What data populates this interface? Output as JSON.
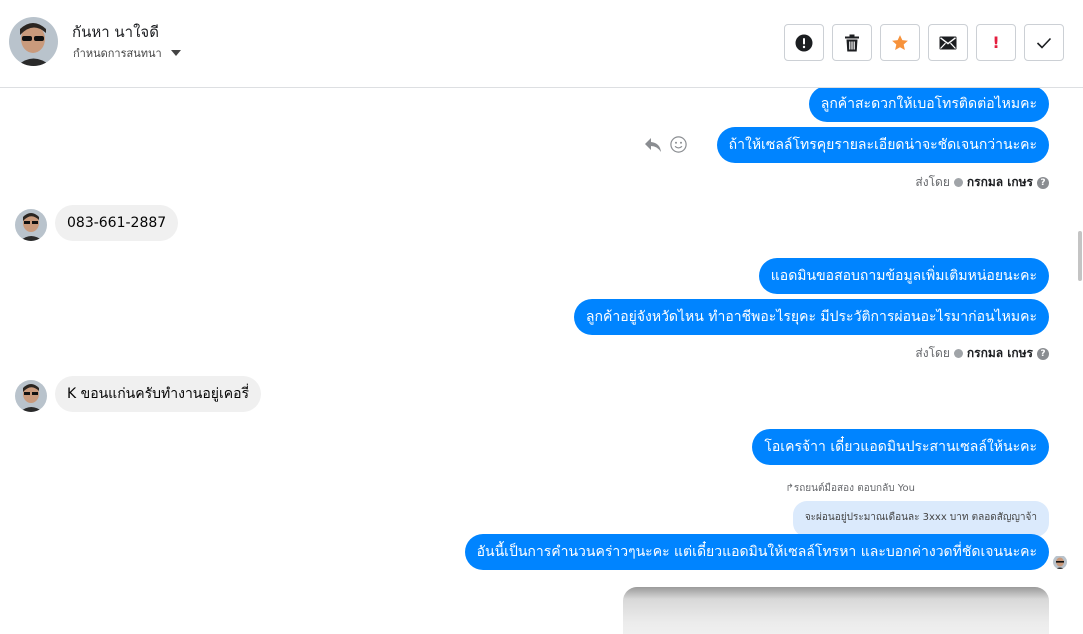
{
  "header": {
    "contact_name": "กันหา นาใจดี",
    "subtitle": "กำหนดการสนทนา",
    "actions": [
      {
        "name": "report-info-button",
        "icon": "exclamation-circle-icon"
      },
      {
        "name": "delete-button",
        "icon": "trash-icon"
      },
      {
        "name": "star-button",
        "icon": "star-icon",
        "color": "#f7923b"
      },
      {
        "name": "mail-button",
        "icon": "envelope-icon"
      },
      {
        "name": "mark-important-button",
        "icon": "exclamation-icon",
        "color": "#e41e3f"
      },
      {
        "name": "mark-done-button",
        "icon": "checkmark-icon"
      }
    ]
  },
  "messages": {
    "m1": "ลูกค้าสะดวกให้เบอโทรติดต่อไหมคะ",
    "m2": "ถ้าให้เซลล์โทรคุยรายละเอียดน่าจะชัดเจนกว่านะคะ",
    "sent_by_1_prefix": "ส่งโดย",
    "sent_by_1_name": "กรกมล เกษร",
    "m3": "083-661-2887",
    "m4": "แอดมินขอสอบถามข้อมูลเพิ่มเติมหน่อยนะคะ",
    "m5": "ลูกค้าอยู่จังหวัดไหน ทำอาชีพอะไรยุคะ มีประวัติการผ่อนอะไรมาก่อนไหมคะ",
    "sent_by_2_prefix": "ส่งโดย",
    "sent_by_2_name": "กรกมล เกษร",
    "m6": "K ขอนแก่นครับทำงานอยู่เคอรี่",
    "m7": "โอเครจ้าา เดี๋ยวแอดมินประสานเซลล์ให้นะคะ",
    "reply_note": "↱รถยนต์มือสอง ตอบกลับ You",
    "quoted_text": "จะผ่อนอยู่ประมาณเดือนละ 3xxx บาท ตลอดสัญญาจ้า",
    "m8": "อันนี้เป็นการคำนวนคร่าวๆนะคะ แต่เดี๋ยวแอดมินให้เซลล์โทรหา และบอกค่างวดที่ชัดเจนนะคะ"
  },
  "colors": {
    "outgoing_bubble": "#0084ff",
    "incoming_bubble": "#f0f0f0",
    "quoted_bubble": "#dbeafc"
  }
}
